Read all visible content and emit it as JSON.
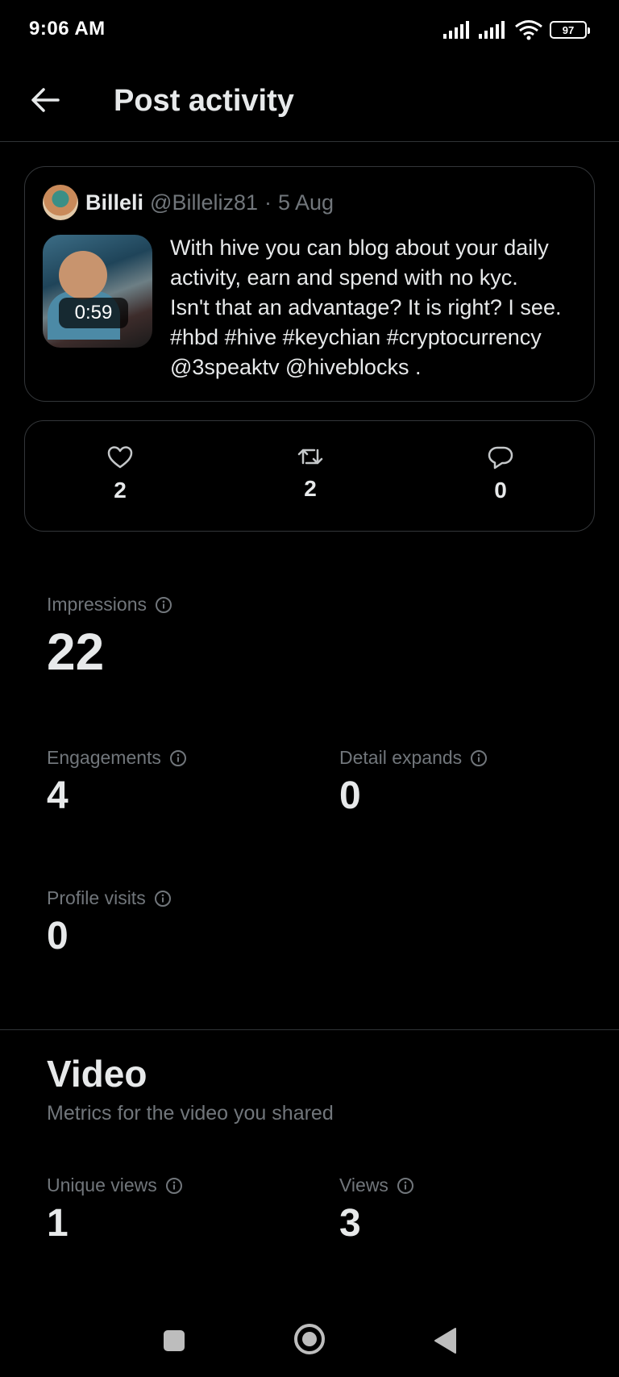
{
  "status": {
    "time": "9:06 AM",
    "battery": "97"
  },
  "header": {
    "title": "Post activity"
  },
  "post": {
    "author_name": "Billeli",
    "author_handle": "@Billeliz81",
    "separator": "·",
    "date": "5 Aug",
    "video_duration": "0:59",
    "text_lines": [
      "With hive you can blog about your daily",
      "activity, earn and spend with no kyc.",
      "Isn't that an advantage? It is right? I see.",
      "#hbd #hive #keychian #cryptocurrency",
      "@3speaktv  @hiveblocks ."
    ]
  },
  "engagement": {
    "likes": "2",
    "reposts": "2",
    "replies": "0"
  },
  "metrics": {
    "impressions": {
      "label": "Impressions",
      "value": "22"
    },
    "engagements": {
      "label": "Engagements",
      "value": "4"
    },
    "detail_expands": {
      "label": "Detail expands",
      "value": "0"
    },
    "profile_visits": {
      "label": "Profile visits",
      "value": "0"
    }
  },
  "video": {
    "title": "Video",
    "subtitle": "Metrics for the video you shared",
    "unique_views": {
      "label": "Unique views",
      "value": "1"
    },
    "views": {
      "label": "Views",
      "value": "3"
    }
  },
  "icons": {
    "back": "arrow-left-icon",
    "like": "heart-icon",
    "repost": "repost-icon",
    "reply": "reply-icon",
    "info": "info-icon",
    "nav_recents": "square-icon",
    "nav_home": "circle-icon",
    "nav_back": "triangle-back-icon"
  },
  "colors": {
    "background": "#000000",
    "primary_text": "#e7e9ea",
    "secondary_text": "#71767b",
    "border": "#333639"
  }
}
